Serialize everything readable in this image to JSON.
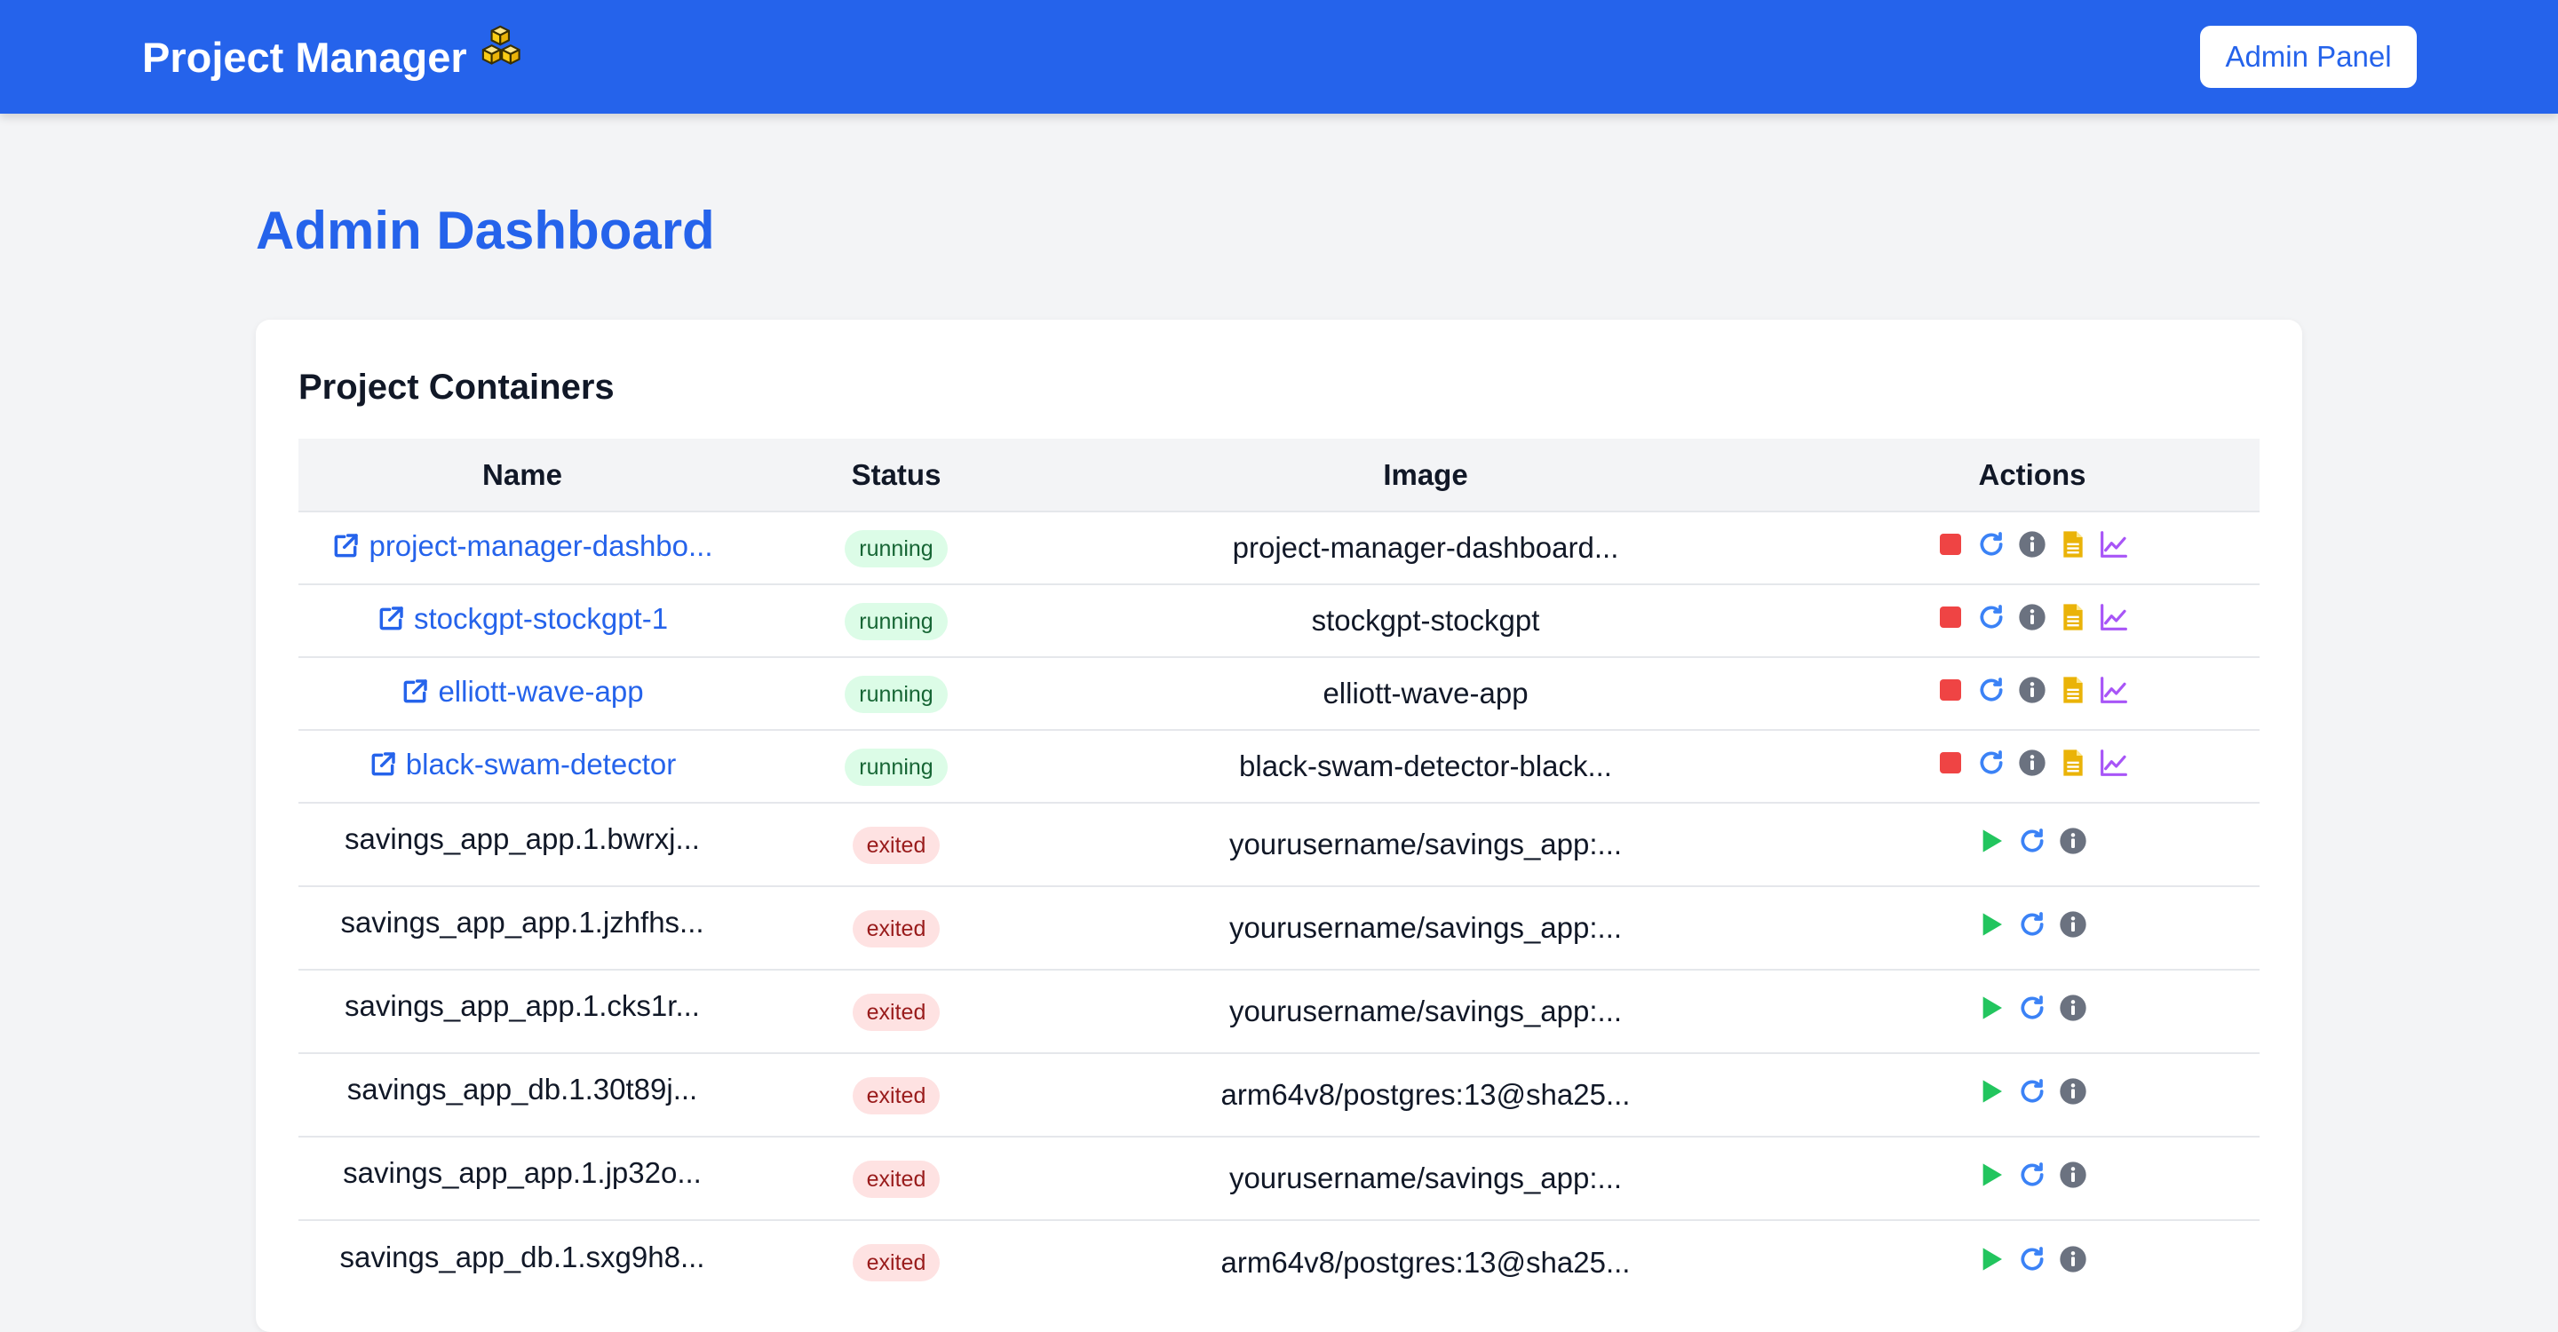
{
  "app": {
    "title": "Project Manager",
    "admin_button": "Admin Panel"
  },
  "page": {
    "title": "Admin Dashboard",
    "section_title": "Project Containers"
  },
  "table": {
    "headers": [
      "Name",
      "Status",
      "Image",
      "Actions"
    ],
    "rows": [
      {
        "name": "project-manager-dashbo...",
        "status": "running",
        "image": "project-manager-dashboard...",
        "linked": true
      },
      {
        "name": "stockgpt-stockgpt-1",
        "status": "running",
        "image": "stockgpt-stockgpt",
        "linked": true
      },
      {
        "name": "elliott-wave-app",
        "status": "running",
        "image": "elliott-wave-app",
        "linked": true
      },
      {
        "name": "black-swam-detector",
        "status": "running",
        "image": "black-swam-detector-black...",
        "linked": true
      },
      {
        "name": "savings_app_app.1.bwrxj...",
        "status": "exited",
        "image": "yourusername/savings_app:...",
        "linked": false
      },
      {
        "name": "savings_app_app.1.jzhfhs...",
        "status": "exited",
        "image": "yourusername/savings_app:...",
        "linked": false
      },
      {
        "name": "savings_app_app.1.cks1r...",
        "status": "exited",
        "image": "yourusername/savings_app:...",
        "linked": false
      },
      {
        "name": "savings_app_db.1.30t89j...",
        "status": "exited",
        "image": "arm64v8/postgres:13@sha25...",
        "linked": false
      },
      {
        "name": "savings_app_app.1.jp32o...",
        "status": "exited",
        "image": "yourusername/savings_app:...",
        "linked": false
      },
      {
        "name": "savings_app_db.1.sxg9h8...",
        "status": "exited",
        "image": "arm64v8/postgres:13@sha25...",
        "linked": false
      }
    ]
  },
  "icons": {
    "brand": "cubes-icon",
    "external_link": "external-link-icon",
    "running_actions": [
      "stop-icon",
      "restart-icon",
      "info-icon",
      "logs-icon",
      "stats-icon"
    ],
    "exited_actions": [
      "play-icon",
      "restart-icon",
      "info-icon"
    ]
  },
  "colors": {
    "primary": "#2563eb",
    "background": "#f3f4f6",
    "running_badge_bg": "#dcfce7",
    "running_badge_text": "#166534",
    "exited_badge_bg": "#fee2e2",
    "exited_badge_text": "#991b1b",
    "stop": "#ef4444",
    "play": "#22c55e",
    "restart": "#3b82f6",
    "info": "#6b7280",
    "logs": "#eab308",
    "stats": "#a855f7"
  }
}
